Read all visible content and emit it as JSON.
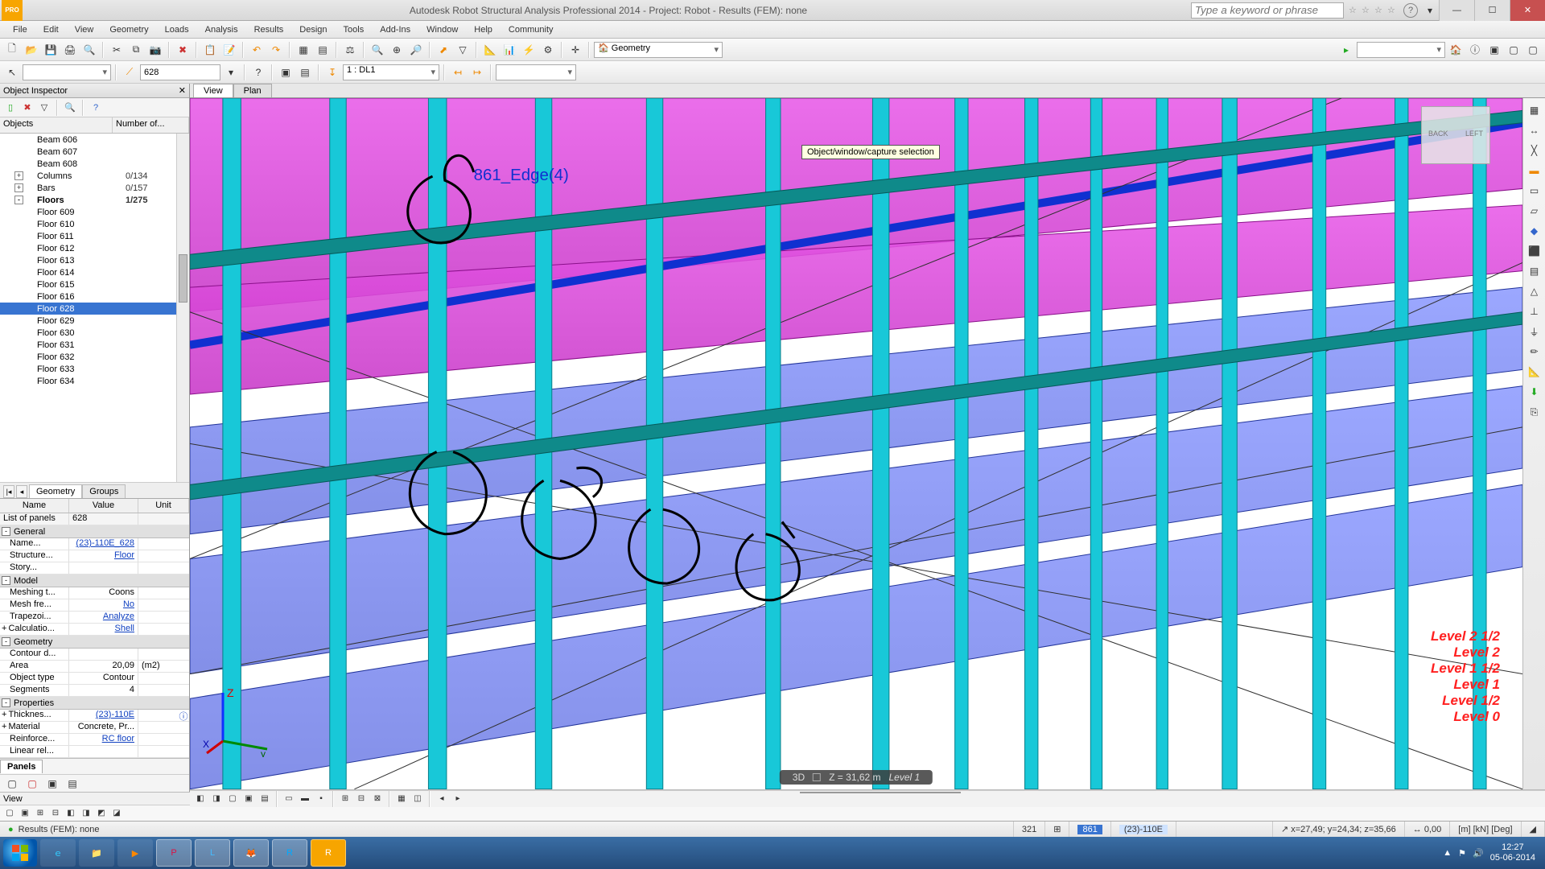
{
  "title": "Autodesk Robot Structural Analysis Professional 2014 - Project: Robot - Results (FEM): none",
  "search_placeholder": "Type a keyword or phrase",
  "menu": [
    "File",
    "Edit",
    "View",
    "Geometry",
    "Loads",
    "Analysis",
    "Results",
    "Design",
    "Tools",
    "Add-Ins",
    "Window",
    "Help",
    "Community"
  ],
  "toolbar2": {
    "geometry_dropdown": "Geometry",
    "layout_dropdown": "",
    "tools_dropdown": ""
  },
  "toolbar3": {
    "select_value": "628",
    "loadcase": "1 : DL1"
  },
  "inspector_title": "Object Inspector",
  "tree_headers": {
    "objects": "Objects",
    "number": "Number of..."
  },
  "tree": [
    {
      "type": "leaf",
      "indent": 3,
      "label": "Beam   606"
    },
    {
      "type": "leaf",
      "indent": 3,
      "label": "Beam   607"
    },
    {
      "type": "leaf",
      "indent": 3,
      "label": "Beam   608"
    },
    {
      "type": "group",
      "indent": 1,
      "exp": "+",
      "icon": "column",
      "label": "Columns",
      "count": "0/134"
    },
    {
      "type": "group",
      "indent": 1,
      "exp": "+",
      "icon": "bar",
      "label": "Bars",
      "count": "0/157"
    },
    {
      "type": "group",
      "indent": 1,
      "exp": "-",
      "icon": "floor",
      "label": "Floors",
      "count": "1/275",
      "bold": true
    },
    {
      "type": "leaf",
      "indent": 3,
      "label": "Floor   609"
    },
    {
      "type": "leaf",
      "indent": 3,
      "label": "Floor   610"
    },
    {
      "type": "leaf",
      "indent": 3,
      "label": "Floor   611"
    },
    {
      "type": "leaf",
      "indent": 3,
      "label": "Floor   612"
    },
    {
      "type": "leaf",
      "indent": 3,
      "label": "Floor   613"
    },
    {
      "type": "leaf",
      "indent": 3,
      "label": "Floor   614"
    },
    {
      "type": "leaf",
      "indent": 3,
      "label": "Floor   615"
    },
    {
      "type": "leaf",
      "indent": 3,
      "label": "Floor   616"
    },
    {
      "type": "leaf",
      "indent": 3,
      "label": "Floor   628",
      "selected": true
    },
    {
      "type": "leaf",
      "indent": 3,
      "label": "Floor   629"
    },
    {
      "type": "leaf",
      "indent": 3,
      "label": "Floor   630"
    },
    {
      "type": "leaf",
      "indent": 3,
      "label": "Floor   631"
    },
    {
      "type": "leaf",
      "indent": 3,
      "label": "Floor   632"
    },
    {
      "type": "leaf",
      "indent": 3,
      "label": "Floor   633"
    },
    {
      "type": "leaf",
      "indent": 3,
      "label": "Floor   634"
    }
  ],
  "tree_tabs": {
    "active": "Geometry",
    "inactive": "Groups"
  },
  "props_headers": {
    "name": "Name",
    "value": "Value",
    "unit": "Unit"
  },
  "props": {
    "list_title": "List of panels",
    "list_value": "628",
    "sections": [
      {
        "title": "General",
        "rows": [
          {
            "n": "Name...",
            "v": "(23)-110E_628",
            "link": true
          },
          {
            "n": "Structure...",
            "v": "Floor",
            "link": true
          },
          {
            "n": "Story...",
            "v": ""
          }
        ]
      },
      {
        "title": "Model",
        "rows": [
          {
            "n": "Meshing t...",
            "v": "Coons"
          },
          {
            "n": "Mesh fre...",
            "v": "No",
            "link": true
          },
          {
            "n": "Trapezoi...",
            "v": "Analyze",
            "link": true
          },
          {
            "n": "Calculatio...",
            "v": "Shell",
            "link": true,
            "pm": "+"
          }
        ]
      },
      {
        "title": "Geometry",
        "rows": [
          {
            "n": "Contour d...",
            "v": ""
          },
          {
            "n": "Area",
            "v": "20,09",
            "u": "(m2)"
          },
          {
            "n": "Object type",
            "v": "Contour"
          },
          {
            "n": "Segments",
            "v": "4"
          }
        ]
      },
      {
        "title": "Properties",
        "rows": [
          {
            "n": "Thicknes...",
            "v": "(23)-110E",
            "link": true,
            "info": true,
            "pm": "+"
          },
          {
            "n": "Material",
            "v": "Concrete, Pr...",
            "pm": "+"
          },
          {
            "n": "Reinforce...",
            "v": "RC floor",
            "link": true
          },
          {
            "n": "Linear rel...",
            "v": ""
          }
        ]
      }
    ]
  },
  "panels_tab": "Panels",
  "view_tabs": {
    "active": "View",
    "inactive": "Plan"
  },
  "viewport": {
    "tooltip": "Object/window/capture selection",
    "edge_label": "861_Edge(4)",
    "info_bar": {
      "mode": "3D",
      "z": "Z = 31,62 m",
      "level": "Level 1"
    },
    "levels": [
      "Level 2 1/2",
      "Level 2",
      "Level 1 1/2",
      "Level 1",
      "Level 1/2",
      "Level 0"
    ],
    "cube": {
      "l": "BACK",
      "r": "LEFT"
    }
  },
  "botview": "View",
  "status": {
    "results": "Results (FEM): none",
    "n1": "321",
    "n2": "861",
    "code": "(23)-110E",
    "coords": "x=27,49; y=24,34; z=35,66",
    "d": "0,00",
    "units": "[m] [kN] [Deg]"
  },
  "clock": {
    "time": "12:27",
    "date": "05-06-2014"
  }
}
